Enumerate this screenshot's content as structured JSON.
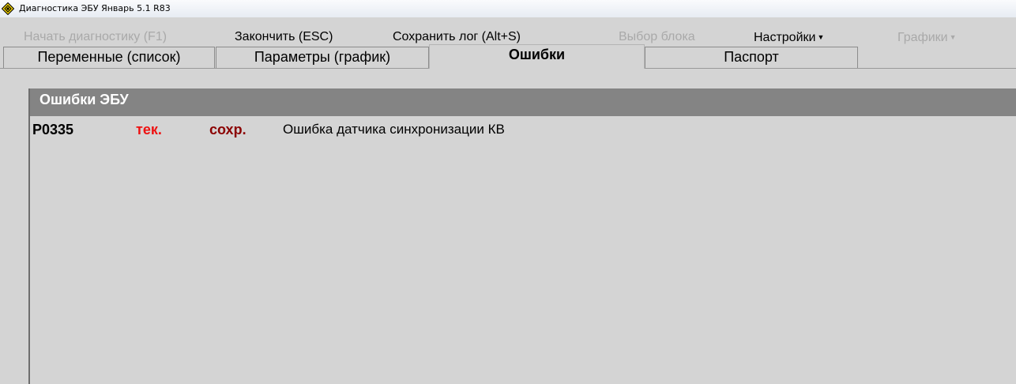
{
  "window": {
    "title": "Диагностика ЭБУ Январь 5.1 R83",
    "icon": "app-diamond-icon"
  },
  "menu": {
    "start_diag": "Начать диагностику (F1)",
    "finish": "Закончить (ESC)",
    "save_log": "Сохранить лог (Alt+S)",
    "select_block": "Выбор блока",
    "settings": "Настройки",
    "graphs": "Графики"
  },
  "tabs": [
    {
      "label": "Переменные (список)"
    },
    {
      "label": "Параметры (график)"
    },
    {
      "label": "Ошибки"
    },
    {
      "label": "Паспорт"
    }
  ],
  "panel": {
    "title": "Ошибки ЭБУ",
    "errors": [
      {
        "code": "P0335",
        "current": "тек.",
        "saved": "сохр.",
        "description": "Ошибка датчика синхронизации КВ"
      }
    ]
  },
  "colors": {
    "current_flag": "#ee1111",
    "saved_flag": "#8b0000",
    "header_bg": "#848484",
    "disabled_text": "#a9a9a9"
  }
}
